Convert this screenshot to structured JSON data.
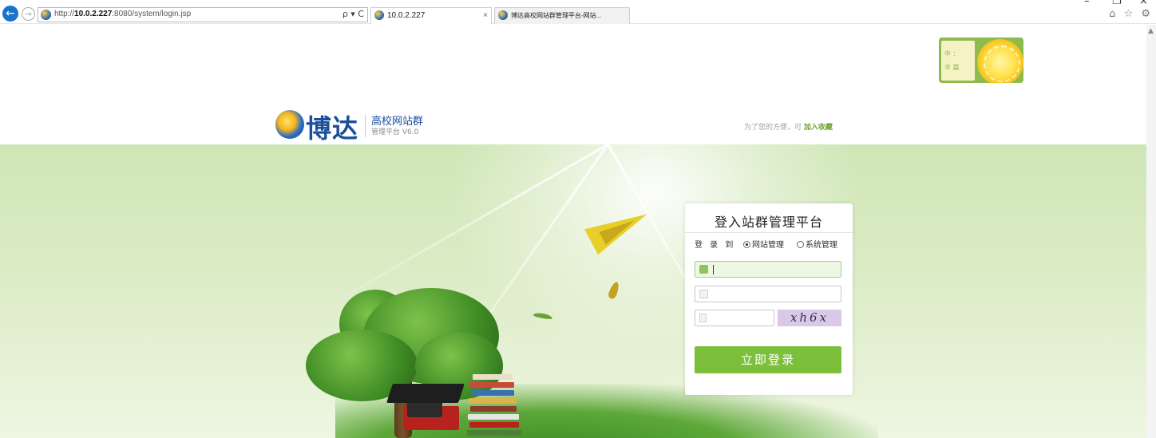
{
  "browser": {
    "back_icon": "back-arrow-icon",
    "forward_icon": "forward-arrow-icon",
    "url_prefix": "http://",
    "url_host": "10.0.2.227",
    "url_rest": ":8080/system/login.jsp",
    "search_tools": "ρ ▾ C",
    "tabs": [
      {
        "title": "10.0.2.227",
        "close": "×"
      },
      {
        "title": "博达高校网站群管理平台-网站..."
      }
    ],
    "window_controls": {
      "minimize": "–",
      "restore": "❐",
      "close": "×"
    },
    "right_icons": "⌂ ☆ ⚙"
  },
  "ad": {
    "chars": [
      "中",
      "：",
      "半",
      "篇"
    ]
  },
  "header": {
    "brand": "博达",
    "subtitle_line1": "高校网站群",
    "subtitle_line2": "管理平台  V6.0",
    "bookmark_text": "为了您的方便，可",
    "bookmark_link": "加入收藏"
  },
  "login": {
    "title": "登入站群管理平台",
    "login_to_label": "登 录 到",
    "options": [
      {
        "label": "网站管理",
        "selected": true
      },
      {
        "label": "系统管理",
        "selected": false
      }
    ],
    "username_value": "",
    "password_value": "",
    "captcha_value": "",
    "captcha_image_text": "xh6x",
    "submit_label": "立即登录"
  },
  "colors": {
    "accent_green": "#7cbf3a",
    "brand_blue": "#1b4f9b",
    "hero_bg": "#d5e9bd"
  }
}
